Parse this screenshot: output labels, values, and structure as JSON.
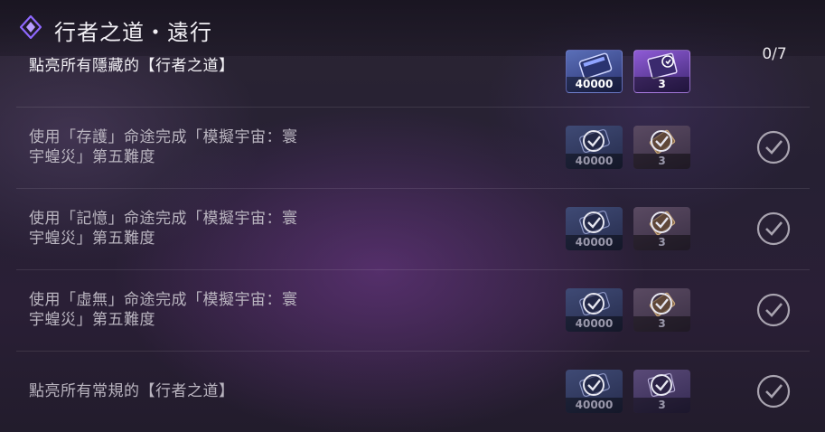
{
  "header": {
    "title": "行者之道・遠行",
    "icon": "purple-diamond-icon"
  },
  "colors": {
    "accent": "#8f68ff",
    "text_active": "#f2f0f5",
    "text_done": "#b9b4bf",
    "check": "#a9a4b0"
  },
  "achievements": [
    {
      "description": "點亮所有隱藏的【行者之道】",
      "status": "in-progress",
      "progress": "0/7",
      "rewards": [
        {
          "icon": "credit-card-icon",
          "count": "40000"
        },
        {
          "icon": "special-reward-icon",
          "count": "3"
        }
      ]
    },
    {
      "description": "使用「存護」命途完成「模擬宇宙：寰\n宇蝗災」第五難度",
      "status": "claimed",
      "rewards": [
        {
          "icon": "credit-card-icon",
          "count": "40000"
        },
        {
          "icon": "material-icon",
          "count": "3"
        }
      ]
    },
    {
      "description": "使用「記憶」命途完成「模擬宇宙：寰\n宇蝗災」第五難度",
      "status": "claimed",
      "rewards": [
        {
          "icon": "credit-card-icon",
          "count": "40000"
        },
        {
          "icon": "material-icon",
          "count": "3"
        }
      ]
    },
    {
      "description": "使用「虛無」命途完成「模擬宇宙：寰\n宇蝗災」第五難度",
      "status": "claimed",
      "rewards": [
        {
          "icon": "credit-card-icon",
          "count": "40000"
        },
        {
          "icon": "material-icon",
          "count": "3"
        }
      ]
    },
    {
      "description": "點亮所有常規的【行者之道】",
      "status": "claimed",
      "rewards": [
        {
          "icon": "credit-card-icon",
          "count": "40000"
        },
        {
          "icon": "special-reward-icon",
          "count": "3"
        }
      ]
    }
  ]
}
